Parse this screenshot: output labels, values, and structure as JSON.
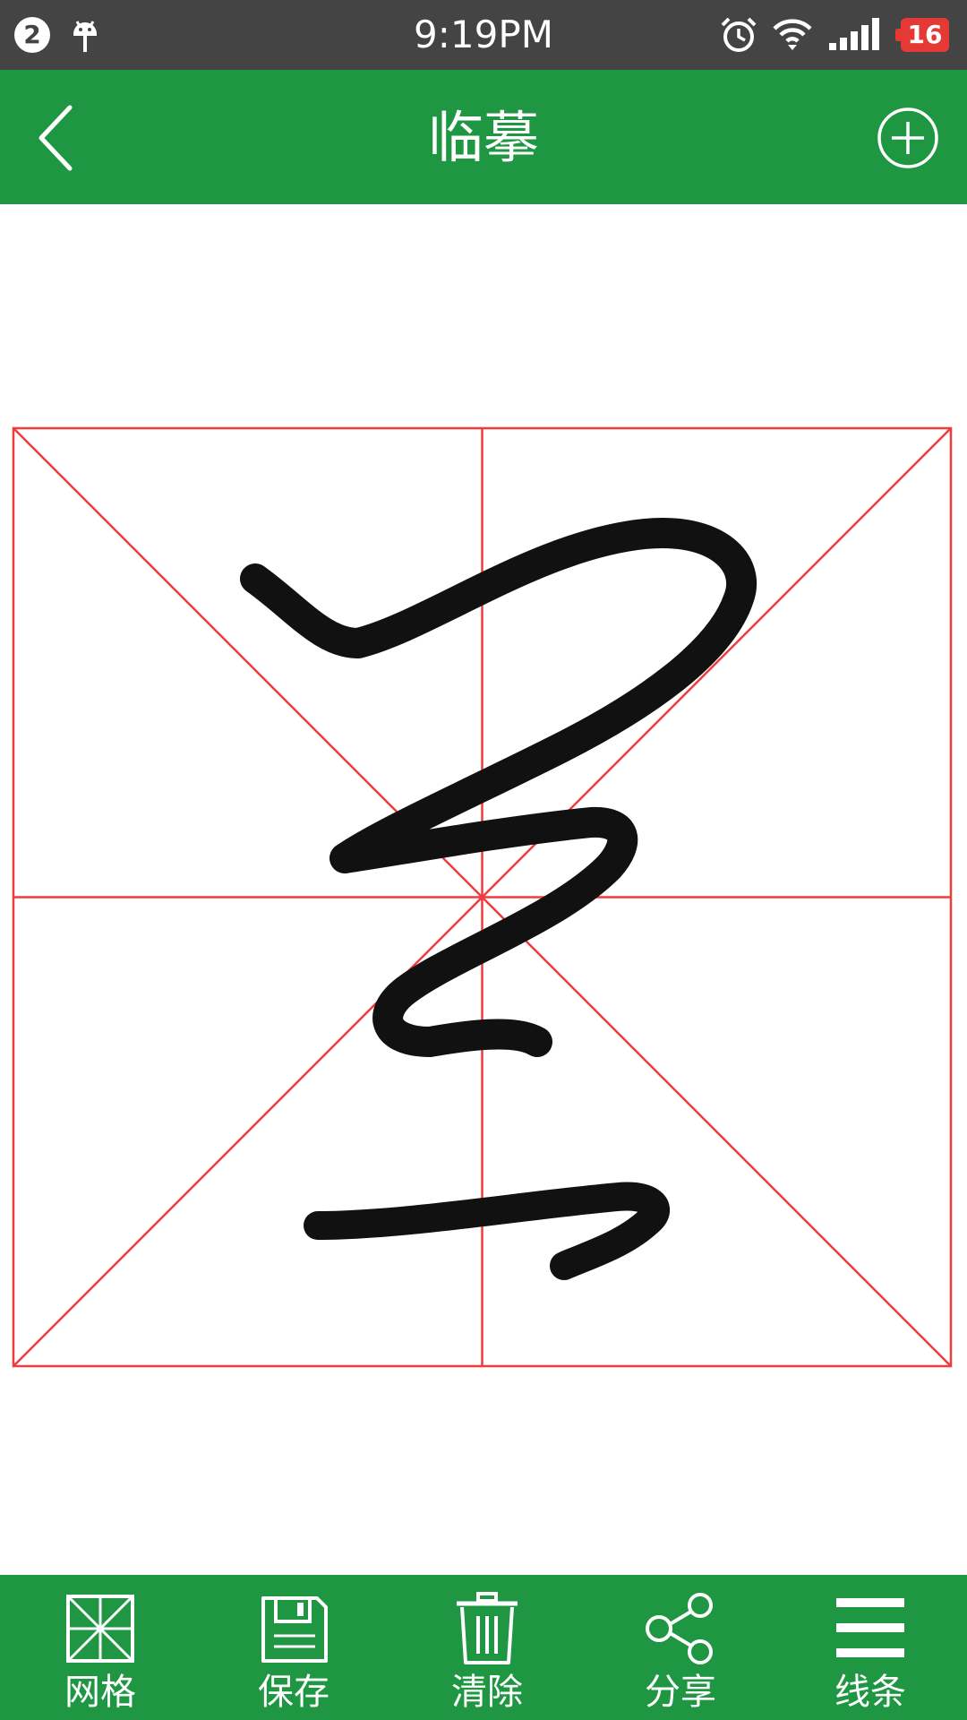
{
  "status_bar": {
    "notification_count": "2",
    "time": "9:19PM",
    "battery": "16"
  },
  "app_bar": {
    "title": "临摹"
  },
  "toolbar": {
    "items": [
      {
        "label": "网格",
        "icon": "grid-icon"
      },
      {
        "label": "保存",
        "icon": "save-icon"
      },
      {
        "label": "清除",
        "icon": "trash-icon"
      },
      {
        "label": "分享",
        "icon": "share-icon"
      },
      {
        "label": "线条",
        "icon": "lines-icon"
      }
    ]
  },
  "colors": {
    "primary": "#1e9642",
    "status_bar": "#444444",
    "grid_line": "#f03c3c",
    "ink": "#111111",
    "battery_low": "#e53935"
  }
}
